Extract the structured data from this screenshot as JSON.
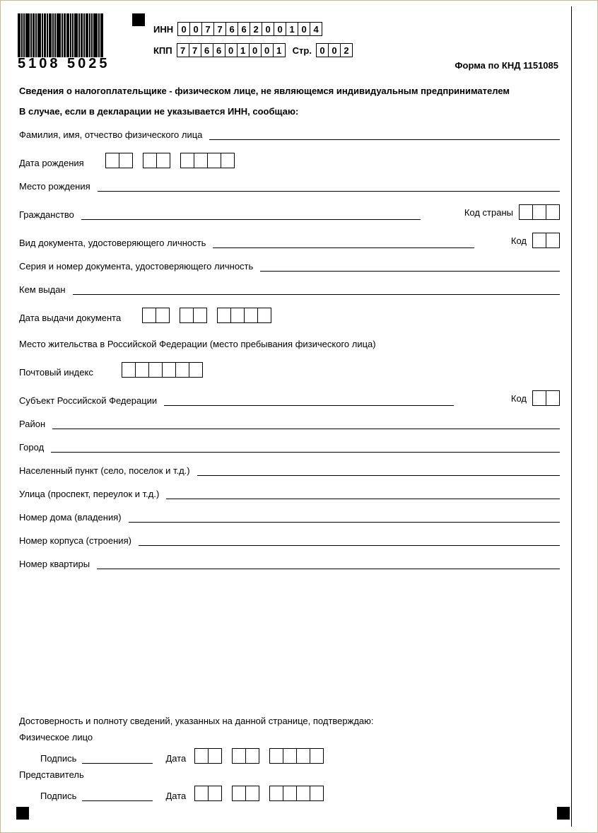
{
  "header": {
    "inn_label": "ИНН",
    "inn": [
      "0",
      "0",
      "7",
      "7",
      "6",
      "6",
      "2",
      "0",
      "0",
      "1",
      "0",
      "4"
    ],
    "kpp_label": "КПП",
    "kpp": [
      "7",
      "7",
      "6",
      "6",
      "0",
      "1",
      "0",
      "0",
      "1"
    ],
    "page_label": "Стр.",
    "page": [
      "0",
      "0",
      "2"
    ],
    "barcode_text": "5108 5025",
    "form_code": "Форма по КНД 1151085"
  },
  "title": "Сведения о налогоплательщике - физическом лице, не являющемся индивидуальным предпринимателем",
  "subtitle": "В случае, если в декларации не указывается ИНН, сообщаю:",
  "fields": {
    "fio": "Фамилия, имя, отчество физического лица",
    "dob": "Дата рождения",
    "birthplace": "Место рождения",
    "citizenship": "Гражданство",
    "country_code": "Код страны",
    "doc_type": "Вид документа, удостоверяющего личность",
    "code": "Код",
    "doc_series": "Серия и номер документа, удостоверяющего личность",
    "issued_by": "Кем выдан",
    "issue_date": "Дата выдачи документа",
    "residence": "Место жительства в Российской Федерации (место пребывания физического лица)",
    "postcode": "Почтовый индекс",
    "subject": "Субъект Российской Федерации",
    "district": "Район",
    "city": "Город",
    "settlement": "Населенный пункт (село, поселок и т.д.)",
    "street": "Улица (проспект, переулок и т.д.)",
    "house": "Номер дома (владения)",
    "building": "Номер корпуса (строения)",
    "flat": "Номер квартиры"
  },
  "footer": {
    "confirm": "Достоверность и полноту сведений, указанных на данной странице, подтверждаю:",
    "individual": "Физическое лицо",
    "representative": "Представитель",
    "signature": "Подпись",
    "date": "Дата"
  }
}
